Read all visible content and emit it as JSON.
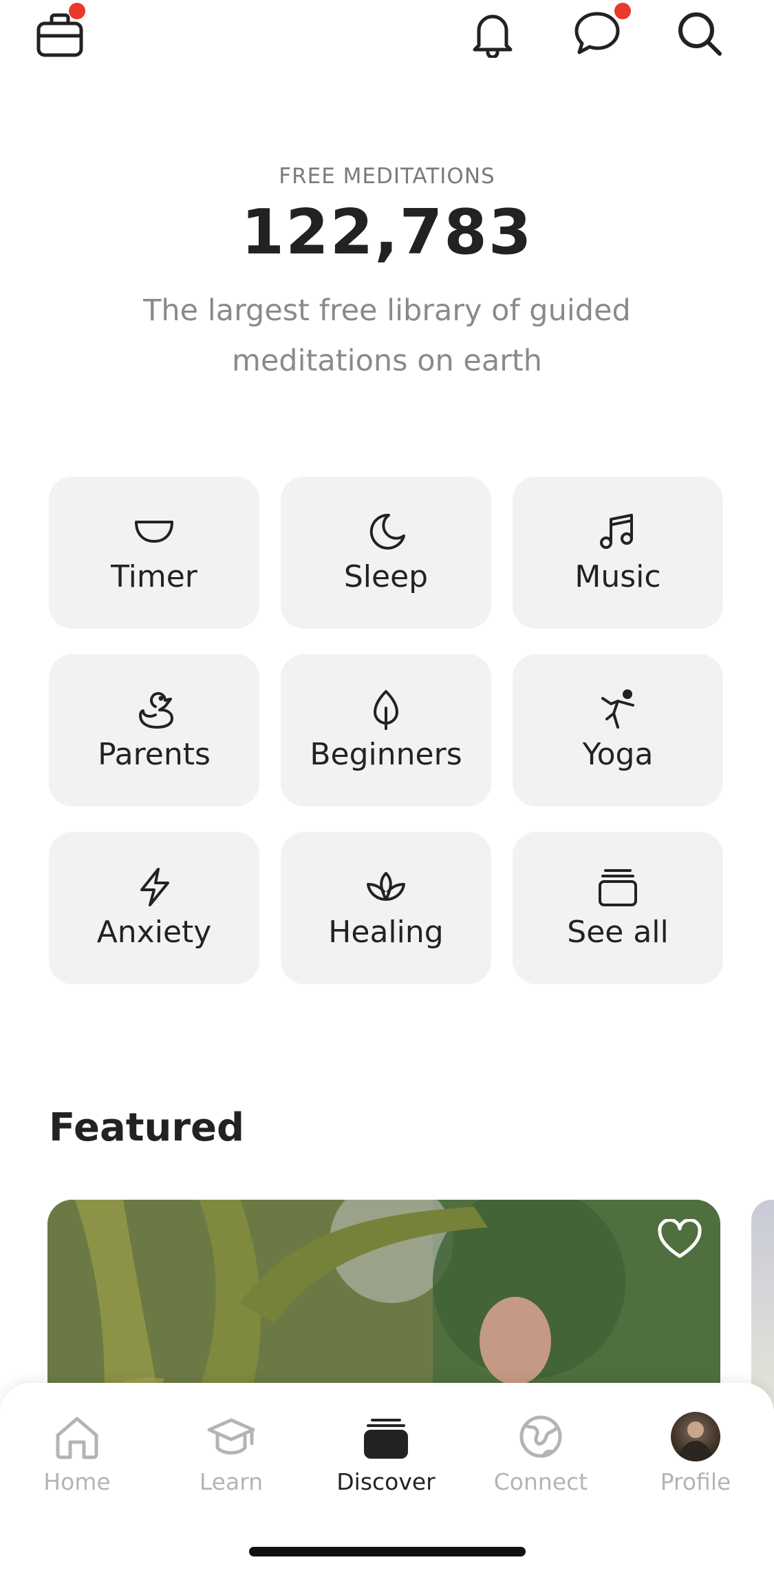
{
  "topbar": {
    "left_icon": "briefcase-icon",
    "right_icons": [
      "bell-icon",
      "chat-bubble-icon",
      "search-icon"
    ],
    "badge_color": "#e8392c"
  },
  "hero": {
    "kicker": "FREE MEDITATIONS",
    "count": "122,783",
    "subtitle": "The largest free library of guided meditations on earth"
  },
  "categories": [
    {
      "label": "Timer",
      "icon": "bowl-icon"
    },
    {
      "label": "Sleep",
      "icon": "moon-icon"
    },
    {
      "label": "Music",
      "icon": "music-note-icon"
    },
    {
      "label": "Parents",
      "icon": "duck-icon"
    },
    {
      "label": "Beginners",
      "icon": "leaf-icon"
    },
    {
      "label": "Yoga",
      "icon": "yoga-pose-icon"
    },
    {
      "label": "Anxiety",
      "icon": "lightning-icon"
    },
    {
      "label": "Healing",
      "icon": "lotus-icon"
    },
    {
      "label": "See all",
      "icon": "stack-icon"
    }
  ],
  "featured": {
    "title": "Featured",
    "card_icon": "heart-icon"
  },
  "bottom_nav": {
    "items": [
      {
        "label": "Home",
        "icon": "home-icon",
        "active": false
      },
      {
        "label": "Learn",
        "icon": "graduation-cap-icon",
        "active": false
      },
      {
        "label": "Discover",
        "icon": "discover-stack-icon",
        "active": true
      },
      {
        "label": "Connect",
        "icon": "globe-icon",
        "active": false
      },
      {
        "label": "Profile",
        "icon": "avatar",
        "active": false
      }
    ]
  },
  "colors": {
    "tile_bg": "#f1f2f2",
    "text_primary": "#222222",
    "text_muted": "#8a8a8a",
    "nav_inactive": "#b4b4b4"
  }
}
